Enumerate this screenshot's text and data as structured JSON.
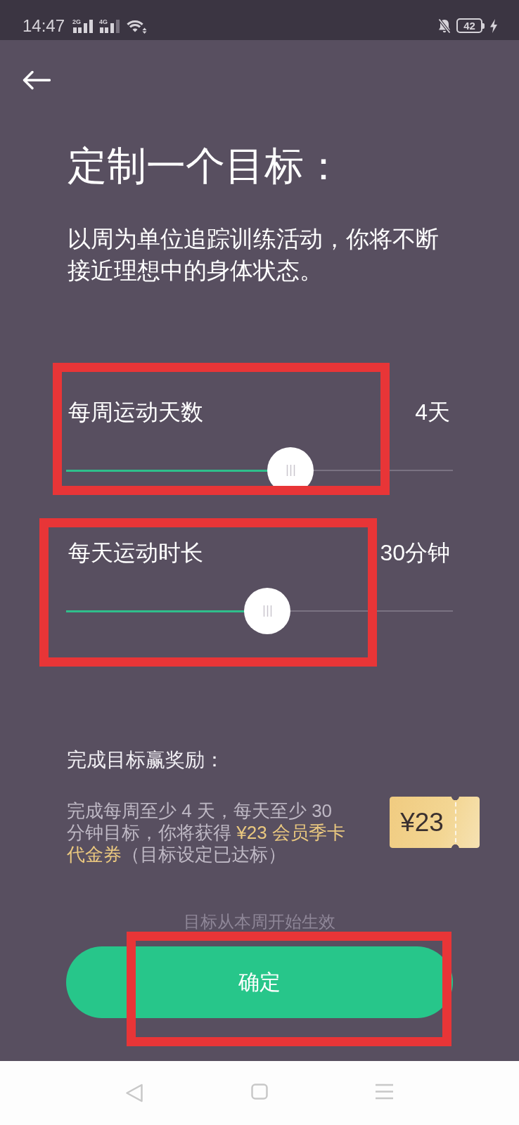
{
  "status_bar": {
    "time": "14:47",
    "networks": [
      {
        "label": "2G"
      },
      {
        "label": "4G"
      }
    ],
    "battery": "42"
  },
  "header": {
    "title": "定制一个目标：",
    "description": "以周为单位追踪训练活动，你将不断接近理想中的身体状态。"
  },
  "sliders": [
    {
      "label": "每周运动天数",
      "reading": "4天",
      "level": 0.58,
      "highlighted": true
    },
    {
      "label": "每天运动时长",
      "reading": "30分钟",
      "level": 0.52,
      "highlighted": true
    }
  ],
  "reward": {
    "heading": "完成目标赢奖励：",
    "text": [
      {
        "text": "完成每周至少 4 天，每天至少 30 分钟目标，你将获得 ",
        "accent": false
      },
      {
        "text": "¥23 会员季卡代金券",
        "accent": true
      },
      {
        "text": "（目标设定已达标）",
        "accent": false
      }
    ],
    "coupon": "¥23"
  },
  "hint": "目标从本周开始生效",
  "confirm_button": {
    "label": "确定",
    "highlighted": true
  }
}
